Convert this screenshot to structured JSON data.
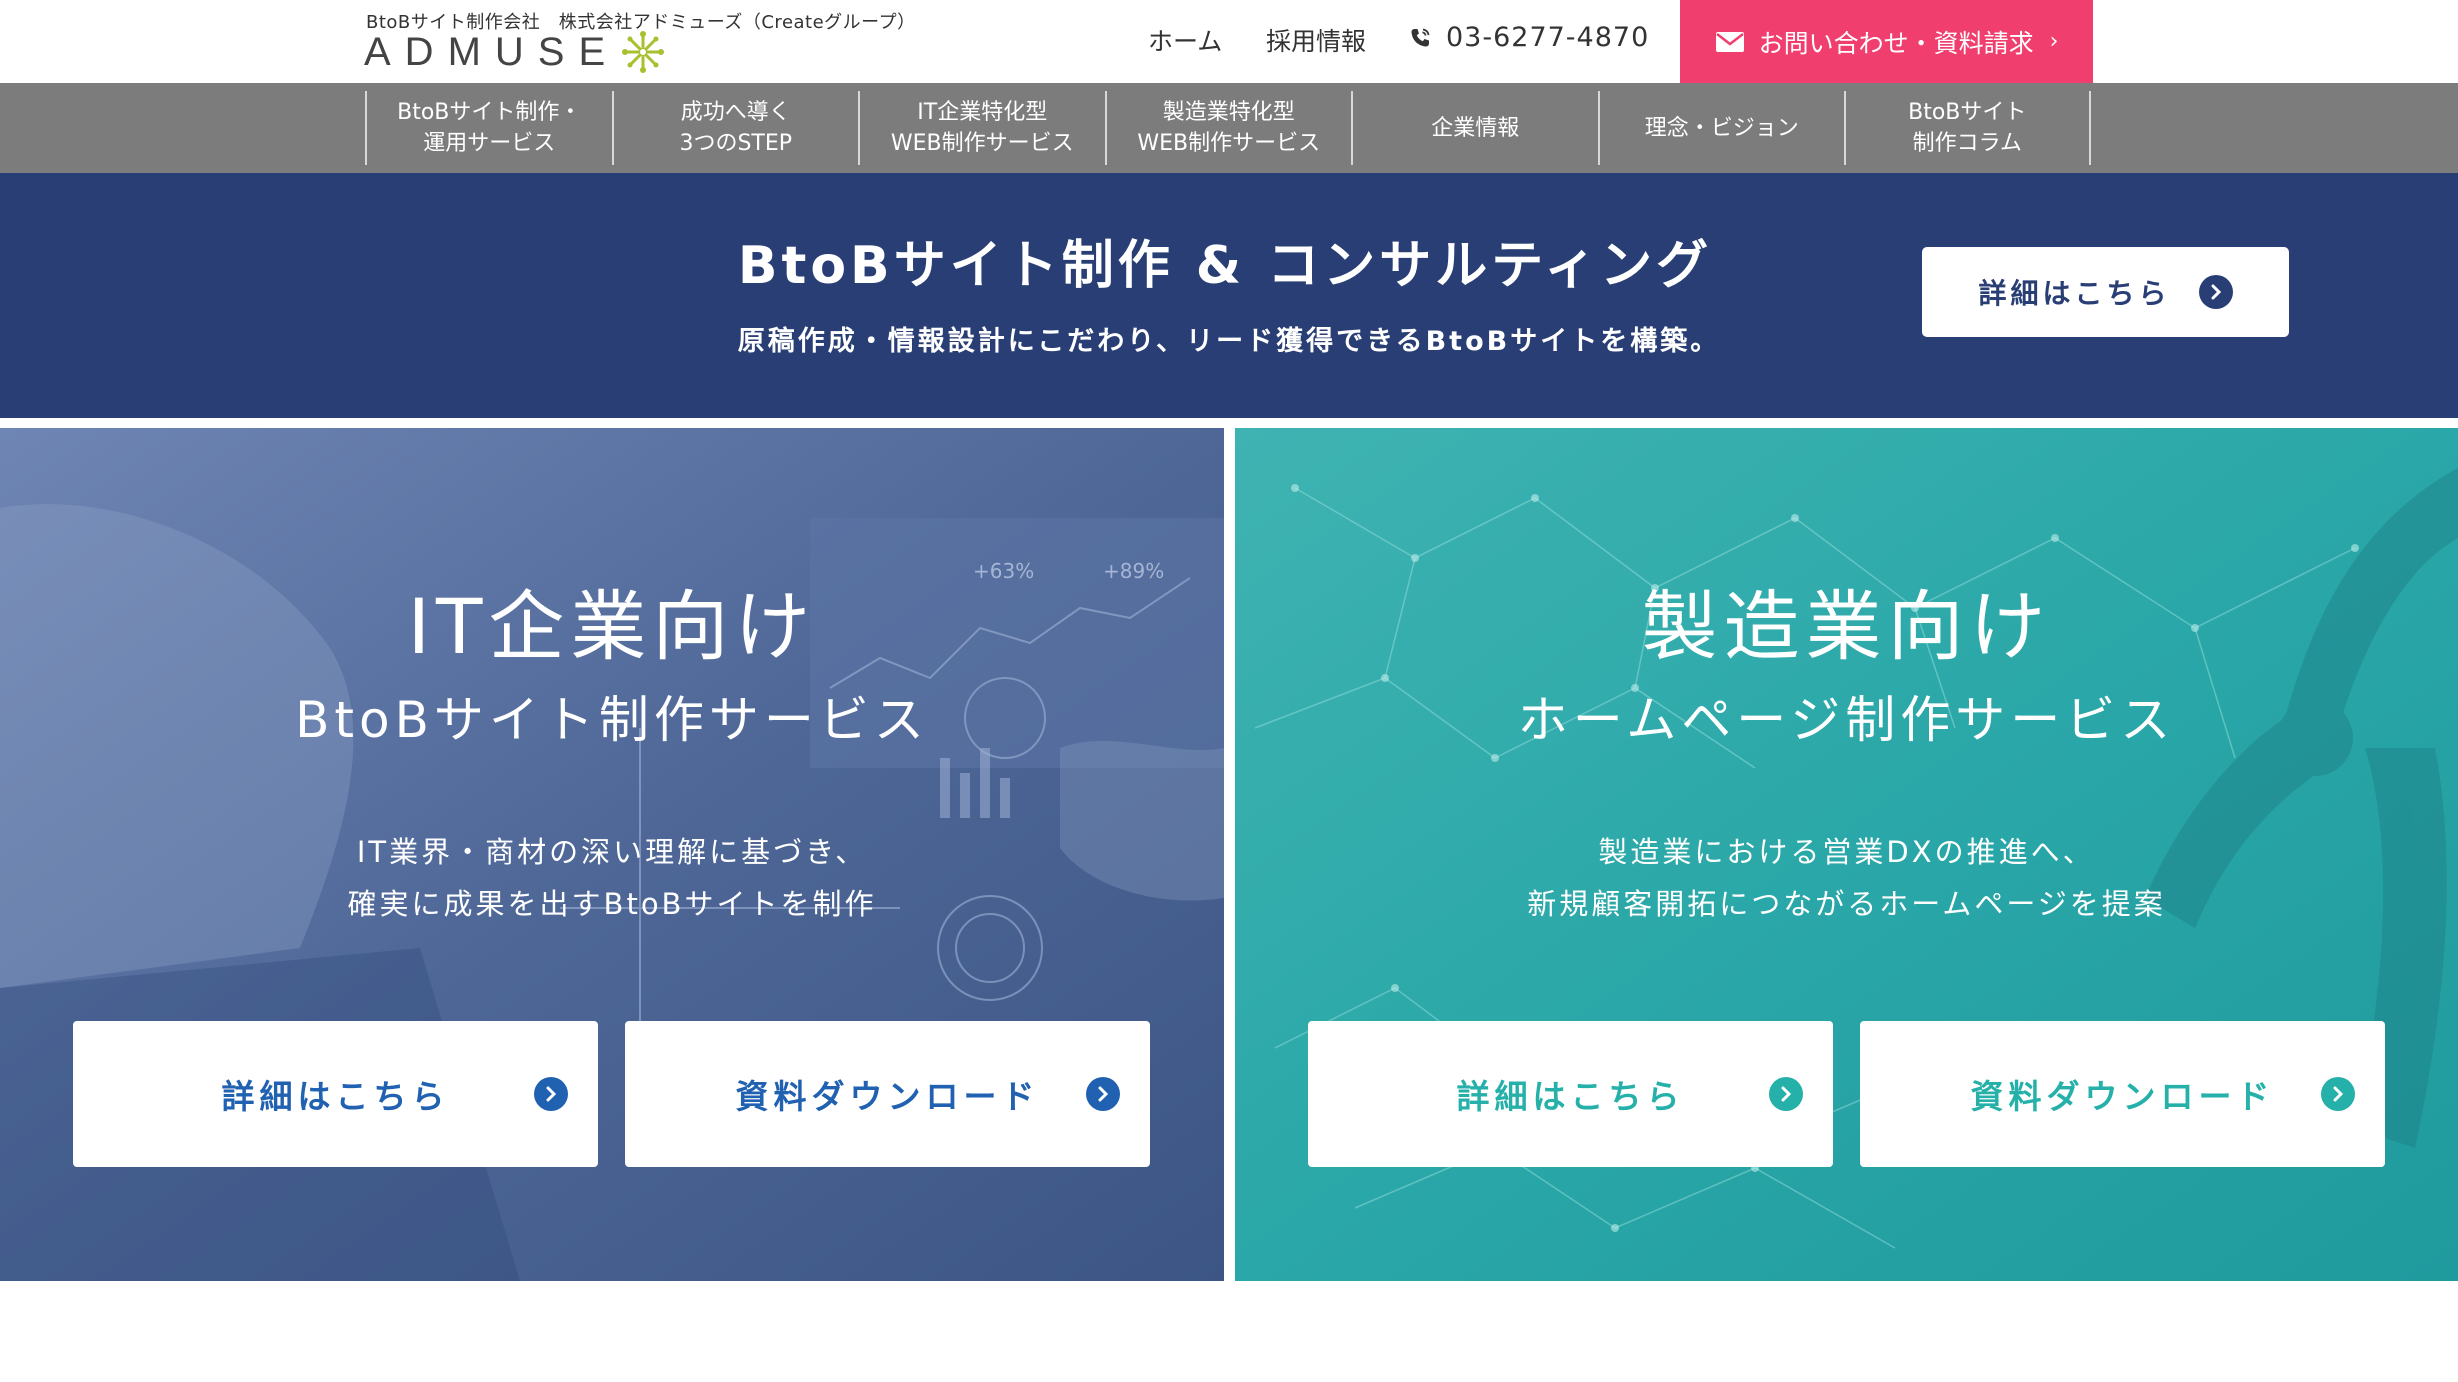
{
  "header": {
    "tagline": "BtoBサイト制作会社　株式会社アドミューズ（Createグループ）",
    "logo_text": "ADMUSE",
    "nav_home": "ホーム",
    "nav_recruit": "採用情報",
    "phone": "03-6277-4870",
    "contact_label": "お問い合わせ・資料請求",
    "contact_color": "#f03f6e"
  },
  "gnav": {
    "items": [
      {
        "line1": "BtoBサイト制作・",
        "line2": "運用サービス"
      },
      {
        "line1": "成功へ導く",
        "line2": "3つのSTEP"
      },
      {
        "line1": "IT企業特化型",
        "line2": "WEB制作サービス"
      },
      {
        "line1": "製造業特化型",
        "line2": "WEB制作サービス"
      },
      {
        "line1": "企業情報",
        "line2": ""
      },
      {
        "line1": "理念・ビジョン",
        "line2": ""
      },
      {
        "line1": "BtoBサイト",
        "line2": "制作コラム"
      }
    ]
  },
  "hero": {
    "title": "BtoBサイト制作 & コンサルティング",
    "subtitle": "原稿作成・情報設計にこだわり、リード獲得できるBtoBサイトを構築。",
    "button": "詳細はこちら",
    "bg_color": "#283e74"
  },
  "panels": {
    "it": {
      "title": "IT企業向け",
      "subtitle": "BtoBサイト制作サービス",
      "desc_line1": "IT業界・商材の深い理解に基づき、",
      "desc_line2": "確実に成果を出すBtoBサイトを制作",
      "detail_button": "詳細はこちら",
      "download_button": "資料ダウンロード",
      "accent_color": "#2161b1"
    },
    "mfg": {
      "title": "製造業向け",
      "subtitle": "ホームページ制作サービス",
      "desc_line1": "製造業における営業DXの推進へ、",
      "desc_line2": "新規顧客開拓につながるホームページを提案",
      "detail_button": "詳細はこちら",
      "download_button": "資料ダウンロード",
      "accent_color": "#25b0a9"
    }
  }
}
